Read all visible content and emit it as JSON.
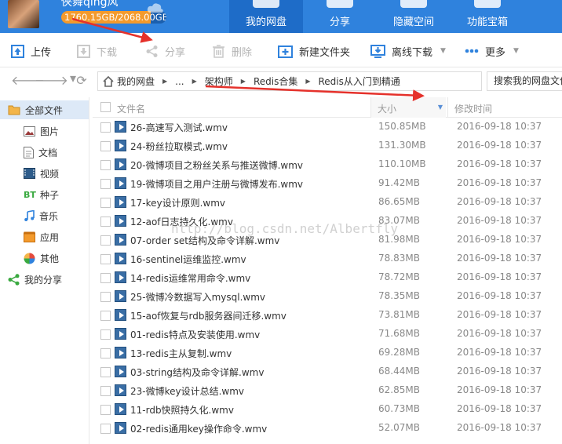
{
  "header": {
    "username": "俠舞qing风",
    "quota_text": "1760.15GB/2068.00GB",
    "quota_fraction": 0.851,
    "tabs": [
      {
        "label": "我的网盘",
        "active": true
      },
      {
        "label": "分享",
        "active": false
      },
      {
        "label": "隐藏空间",
        "active": false
      },
      {
        "label": "功能宝箱",
        "active": false
      }
    ]
  },
  "toolbar": {
    "upload_label": "上传",
    "download_label": "下载",
    "share_label": "分享",
    "delete_label": "删除",
    "new_folder_label": "新建文件夹",
    "offline_download_label": "离线下载",
    "more_label": "更多"
  },
  "breadcrumb": {
    "items": [
      "我的网盘",
      "...",
      "架构师",
      "Redis合集",
      "Redis从入门到精通"
    ]
  },
  "search": {
    "placeholder": "搜索我的网盘文件"
  },
  "sidebar": {
    "items": [
      {
        "label": "全部文件",
        "icon": "folder-icon",
        "active": true
      },
      {
        "label": "图片",
        "icon": "image-icon"
      },
      {
        "label": "文档",
        "icon": "document-icon"
      },
      {
        "label": "视频",
        "icon": "video-icon"
      },
      {
        "label": "种子",
        "icon": "bt-icon",
        "icon_text": "BT"
      },
      {
        "label": "音乐",
        "icon": "music-icon"
      },
      {
        "label": "应用",
        "icon": "app-icon"
      },
      {
        "label": "其他",
        "icon": "other-icon"
      },
      {
        "label": "我的分享",
        "icon": "share-icon"
      }
    ]
  },
  "table": {
    "columns": {
      "name": "文件名",
      "size": "大小",
      "date": "修改时间"
    },
    "rows": [
      {
        "name": "26-高速写入测试.wmv",
        "size": "150.85MB",
        "date": "2016-09-18 10:37"
      },
      {
        "name": "24-粉丝拉取模式.wmv",
        "size": "131.30MB",
        "date": "2016-09-18 10:37"
      },
      {
        "name": "20-微博项目之粉丝关系与推送微博.wmv",
        "size": "110.10MB",
        "date": "2016-09-18 10:37"
      },
      {
        "name": "19-微博项目之用户注册与微博发布.wmv",
        "size": "91.42MB",
        "date": "2016-09-18 10:37"
      },
      {
        "name": "17-key设计原则.wmv",
        "size": "86.65MB",
        "date": "2016-09-18 10:37"
      },
      {
        "name": "12-aof日志持久化.wmv",
        "size": "83.07MB",
        "date": "2016-09-18 10:37"
      },
      {
        "name": "07-order set结构及命令详解.wmv",
        "size": "81.98MB",
        "date": "2016-09-18 10:37"
      },
      {
        "name": "16-sentinel运维监控.wmv",
        "size": "78.83MB",
        "date": "2016-09-18 10:37"
      },
      {
        "name": "14-redis运维常用命令.wmv",
        "size": "78.72MB",
        "date": "2016-09-18 10:37"
      },
      {
        "name": "25-微博冷数据写入mysql.wmv",
        "size": "78.35MB",
        "date": "2016-09-18 10:37"
      },
      {
        "name": "15-aof恢复与rdb服务器间迁移.wmv",
        "size": "73.81MB",
        "date": "2016-09-18 10:37"
      },
      {
        "name": "01-redis特点及安装使用.wmv",
        "size": "71.68MB",
        "date": "2016-09-18 10:37"
      },
      {
        "name": "13-redis主从复制.wmv",
        "size": "69.28MB",
        "date": "2016-09-18 10:37"
      },
      {
        "name": "03-string结构及命令详解.wmv",
        "size": "68.44MB",
        "date": "2016-09-18 10:37"
      },
      {
        "name": "23-微博key设计总结.wmv",
        "size": "62.85MB",
        "date": "2016-09-18 10:37"
      },
      {
        "name": "11-rdb快照持久化.wmv",
        "size": "60.73MB",
        "date": "2016-09-18 10:37"
      },
      {
        "name": "02-redis通用key操作命令.wmv",
        "size": "52.07MB",
        "date": "2016-09-18 10:37"
      }
    ]
  },
  "watermark": {
    "text": "http://blog.csdn.net/Albertfly"
  },
  "colors": {
    "header_bg": "#2f82dd",
    "active_tab": "#1e6cc8",
    "quota_fill": "#f39a2c",
    "annotation_arrow": "#e5312b"
  }
}
